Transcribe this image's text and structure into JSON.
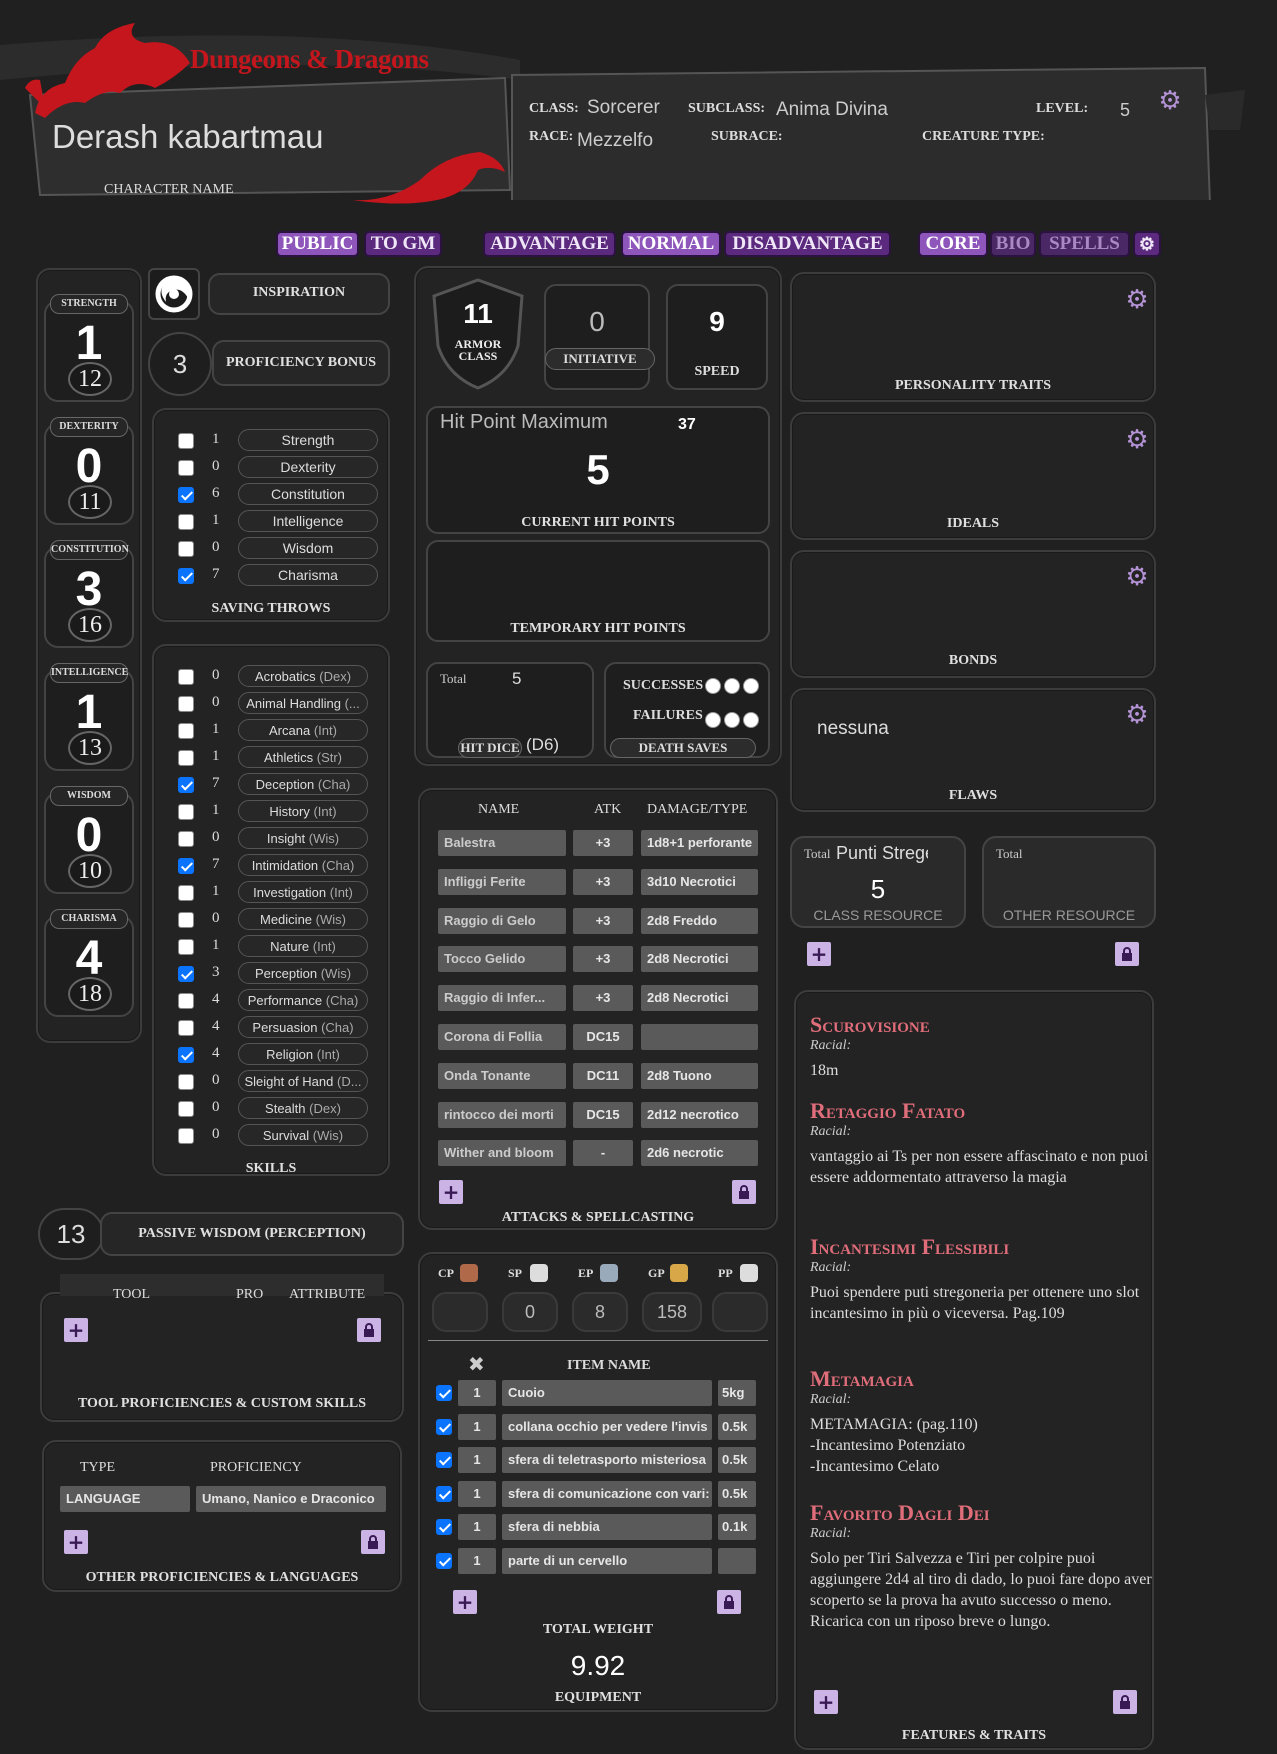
{
  "header": {
    "logo": "Dungeons & Dragons",
    "character_name": "Derash kabartmau",
    "character_name_label": "CHARACTER NAME",
    "class_label": "CLASS:",
    "class": "Sorcerer",
    "subclass_label": "SUBCLASS:",
    "subclass": "Anima Divina",
    "level_label": "LEVEL:",
    "level": "5",
    "race_label": "RACE:",
    "race": "Mezzelfo",
    "subrace_label": "SUBRACE:",
    "creature_type_label": "CREATURE TYPE:"
  },
  "toolbar": {
    "public": "PUBLIC",
    "to_gm": "TO GM",
    "advantage": "ADVANTAGE",
    "normal": "NORMAL",
    "disadvantage": "DISADVANTAGE",
    "core": "CORE",
    "bio": "BIO",
    "spells": "SPELLS"
  },
  "abilities": [
    {
      "name": "STRENGTH",
      "mod": "1",
      "score": "12"
    },
    {
      "name": "DEXTERITY",
      "mod": "0",
      "score": "11"
    },
    {
      "name": "CONSTITUTION",
      "mod": "3",
      "score": "16"
    },
    {
      "name": "INTELLIGENCE",
      "mod": "1",
      "score": "13"
    },
    {
      "name": "WISDOM",
      "mod": "0",
      "score": "10"
    },
    {
      "name": "CHARISMA",
      "mod": "4",
      "score": "18"
    }
  ],
  "inspiration_label": "INSPIRATION",
  "proficiency_bonus": "3",
  "proficiency_bonus_label": "PROFICIENCY BONUS",
  "saving_throws": {
    "label": "SAVING THROWS",
    "items": [
      {
        "name": "Strength",
        "value": "1",
        "checked": false
      },
      {
        "name": "Dexterity",
        "value": "0",
        "checked": false
      },
      {
        "name": "Constitution",
        "value": "6",
        "checked": true
      },
      {
        "name": "Intelligence",
        "value": "1",
        "checked": false
      },
      {
        "name": "Wisdom",
        "value": "0",
        "checked": false
      },
      {
        "name": "Charisma",
        "value": "7",
        "checked": true
      }
    ]
  },
  "skills": {
    "label": "SKILLS",
    "items": [
      {
        "name": "Acrobatics",
        "attr": "(Dex)",
        "value": "0",
        "checked": false
      },
      {
        "name": "Animal Handling",
        "attr": "(...",
        "value": "0",
        "checked": false
      },
      {
        "name": "Arcana",
        "attr": "(Int)",
        "value": "1",
        "checked": false
      },
      {
        "name": "Athletics",
        "attr": "(Str)",
        "value": "1",
        "checked": false
      },
      {
        "name": "Deception",
        "attr": "(Cha)",
        "value": "7",
        "checked": true
      },
      {
        "name": "History",
        "attr": "(Int)",
        "value": "1",
        "checked": false
      },
      {
        "name": "Insight",
        "attr": "(Wis)",
        "value": "0",
        "checked": false
      },
      {
        "name": "Intimidation",
        "attr": "(Cha)",
        "value": "7",
        "checked": true
      },
      {
        "name": "Investigation",
        "attr": "(Int)",
        "value": "1",
        "checked": false
      },
      {
        "name": "Medicine",
        "attr": "(Wis)",
        "value": "0",
        "checked": false
      },
      {
        "name": "Nature",
        "attr": "(Int)",
        "value": "1",
        "checked": false
      },
      {
        "name": "Perception",
        "attr": "(Wis)",
        "value": "3",
        "checked": true
      },
      {
        "name": "Performance",
        "attr": "(Cha)",
        "value": "4",
        "checked": false
      },
      {
        "name": "Persuasion",
        "attr": "(Cha)",
        "value": "4",
        "checked": false
      },
      {
        "name": "Religion",
        "attr": "(Int)",
        "value": "4",
        "checked": true
      },
      {
        "name": "Sleight of Hand",
        "attr": "(D...",
        "value": "0",
        "checked": false
      },
      {
        "name": "Stealth",
        "attr": "(Dex)",
        "value": "0",
        "checked": false
      },
      {
        "name": "Survival",
        "attr": "(Wis)",
        "value": "0",
        "checked": false
      }
    ]
  },
  "passive": {
    "value": "13",
    "label": "PASSIVE WISDOM (PERCEPTION)"
  },
  "tools": {
    "col_tool": "TOOL",
    "col_pro": "PRO",
    "col_attribute": "ATTRIBUTE",
    "label": "TOOL PROFICIENCIES & CUSTOM SKILLS"
  },
  "other_prof": {
    "col_type": "TYPE",
    "col_prof": "PROFICIENCY",
    "row_type": "LANGUAGE",
    "row_prof": "Umano, Nanico e Draconico",
    "label": "OTHER PROFICIENCIES & LANGUAGES"
  },
  "combat": {
    "ac": "11",
    "ac_label": "ARMOR CLASS",
    "initiative": "0",
    "initiative_label": "INITIATIVE",
    "speed": "9",
    "speed_label": "SPEED",
    "hp_max_label": "Hit Point Maximum",
    "hp_max": "37",
    "hp_current": "5",
    "hp_current_label": "CURRENT HIT POINTS",
    "temp_hp_label": "TEMPORARY HIT POINTS",
    "hd_total_label": "Total",
    "hd_total": "5",
    "hd_label": "HIT DICE",
    "hd_die": "(D6)",
    "successes_label": "SUCCESSES",
    "failures_label": "FAILURES",
    "death_saves_label": "DEATH SAVES"
  },
  "attacks": {
    "col_name": "NAME",
    "col_atk": "ATK",
    "col_dmg": "DAMAGE/TYPE",
    "label": "ATTACKS & SPELLCASTING",
    "rows": [
      {
        "name": "Balestra",
        "atk": "+3",
        "dmg": "1d8+1 perforante"
      },
      {
        "name": "Infliggi Ferite",
        "atk": "+3",
        "dmg": "3d10 Necrotici"
      },
      {
        "name": "Raggio di Gelo",
        "atk": "+3",
        "dmg": "2d8 Freddo"
      },
      {
        "name": "Tocco Gelido",
        "atk": "+3",
        "dmg": "2d8 Necrotici"
      },
      {
        "name": "Raggio di Infer...",
        "atk": "+3",
        "dmg": "2d8 Necrotici"
      },
      {
        "name": "Corona di Follia",
        "atk": "DC15",
        "dmg": ""
      },
      {
        "name": "Onda Tonante",
        "atk": "DC11",
        "dmg": "2d8 Tuono"
      },
      {
        "name": "rintocco dei morti",
        "atk": "DC15",
        "dmg": "2d12 necrotico"
      },
      {
        "name": "Wither and bloom",
        "atk": "-",
        "dmg": "2d6 necrotic"
      }
    ]
  },
  "coins": [
    {
      "label": "CP",
      "value": ""
    },
    {
      "label": "SP",
      "value": "0"
    },
    {
      "label": "EP",
      "value": "8"
    },
    {
      "label": "GP",
      "value": "158"
    },
    {
      "label": "PP",
      "value": ""
    }
  ],
  "equipment": {
    "col_item": "ITEM NAME",
    "total_weight_label": "TOTAL WEIGHT",
    "total_weight": "9.92",
    "label": "EQUIPMENT",
    "rows": [
      {
        "qty": "1",
        "name": "Cuoio",
        "weight": "5kg"
      },
      {
        "qty": "1",
        "name": "collana occhio per vedere l'invis",
        "weight": "0.5k"
      },
      {
        "qty": "1",
        "name": "sfera di teletrasporto misteriosa",
        "weight": "0.5k"
      },
      {
        "qty": "1",
        "name": "sfera di comunicazione con vari:",
        "weight": "0.5k"
      },
      {
        "qty": "1",
        "name": "sfera di nebbia",
        "weight": "0.1k"
      },
      {
        "qty": "1",
        "name": "parte di un cervello",
        "weight": ""
      }
    ]
  },
  "traits": {
    "personality": "PERSONALITY TRAITS",
    "ideals": "IDEALS",
    "bonds": "BONDS",
    "flaws": "FLAWS",
    "flaws_value": "nessuna"
  },
  "resources": {
    "class_total_label": "Total",
    "class_name": "Punti Stregе",
    "class_value": "5",
    "class_label": "CLASS RESOURCE",
    "other_total_label": "Total",
    "other_label": "OTHER RESOURCE"
  },
  "features": {
    "label": "FEATURES & TRAITS",
    "items": [
      {
        "title": "Scurovisione",
        "sub": "Racial:",
        "body": "18m"
      },
      {
        "title": "Retaggio Fatato",
        "sub": "Racial:",
        "body": "vantaggio ai Ts per non essere affascinato e non puoi essere addormentato attraverso la magia"
      },
      {
        "title": "Incantesimi Flessibili",
        "sub": "Racial:",
        "body": "Puoi spendere puti stregoneria per ottenere uno slot incantesimo in più o viceversa. Pag.109"
      },
      {
        "title": "Metamagia",
        "sub": "Racial:",
        "body": "METAMAGIA: (pag.110)\n-Incantesimo Potenziato\n-Incantesimo Celato"
      },
      {
        "title": "Favorito Dagli Dei",
        "sub": "Racial:",
        "body": "Solo per Tiri Salvezza e Tiri per colpire puoi aggiungere 2d4 al tiro di dado, lo puoi fare dopo aver scoperto se la prova ha avuto successo o meno. Ricarica con un riposo breve o lungo."
      }
    ]
  },
  "colors": {
    "accent": "#8e55bb",
    "feature_title": "#e06d7a",
    "dragon_red": "#c4161c"
  }
}
